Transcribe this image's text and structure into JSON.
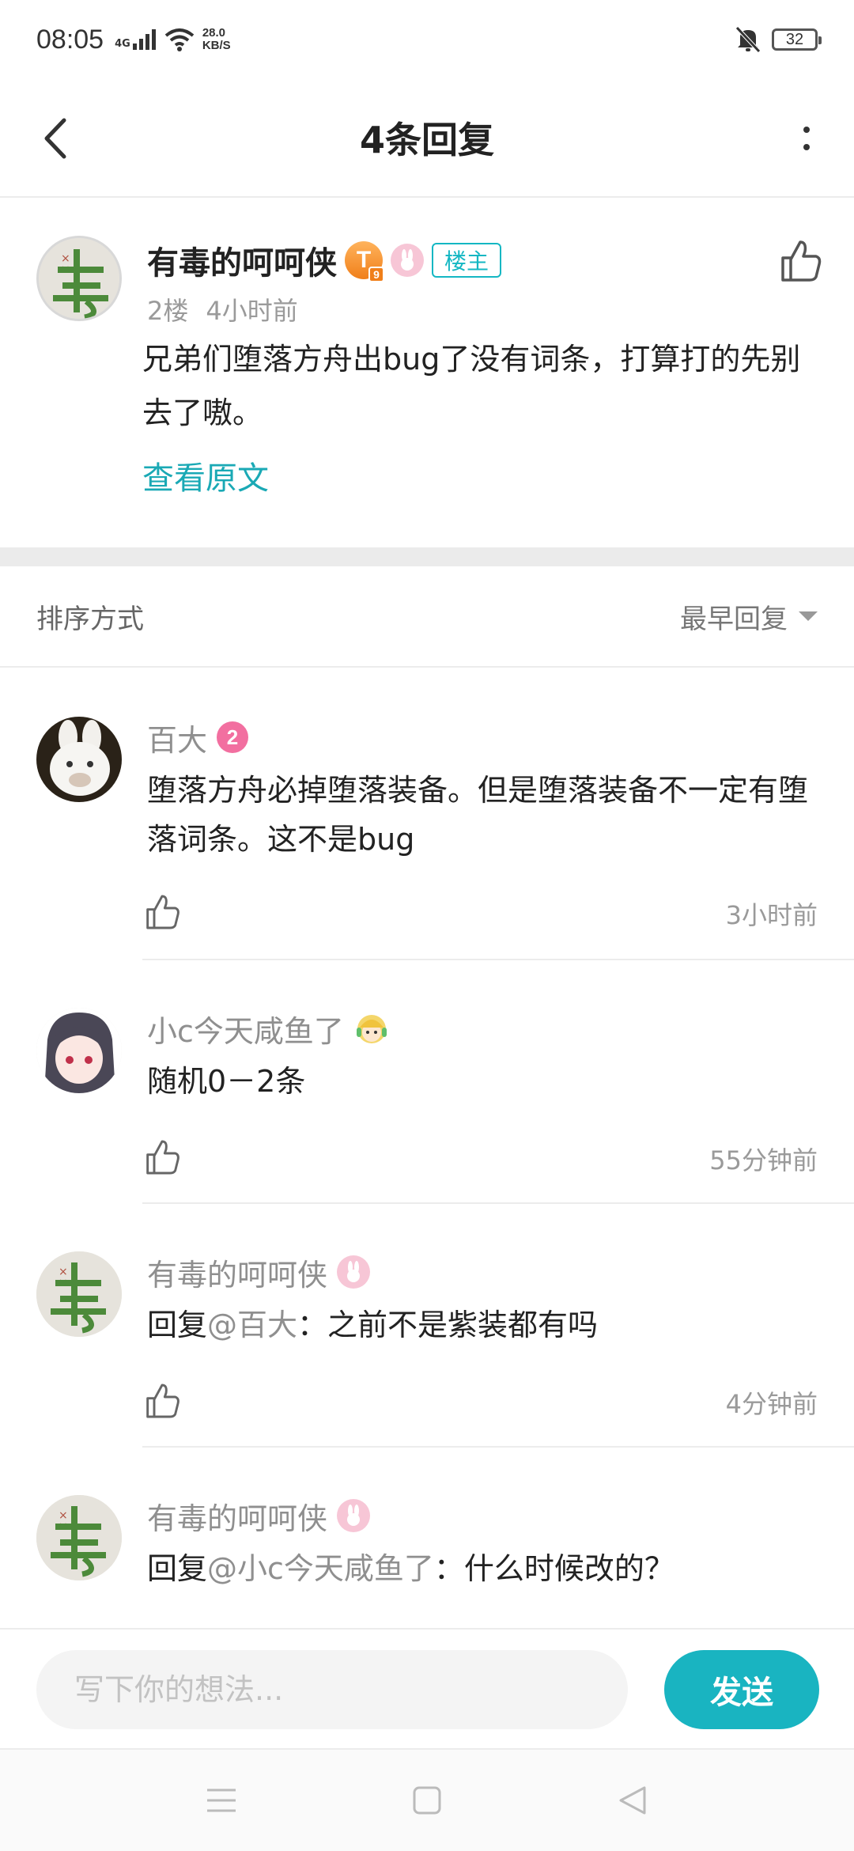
{
  "status_bar": {
    "time": "08:05",
    "network": "4G",
    "speed_value": "28.0",
    "speed_unit": "KB/S",
    "battery": "32"
  },
  "header": {
    "title": "4条回复"
  },
  "post": {
    "author": "有毒的呵呵侠",
    "level_badge": "T",
    "level_sub": "9",
    "owner_tag": "楼主",
    "floor": "2楼",
    "time": "4小时前",
    "content": "兄弟们堕落方舟出bug了没有词条，打算打的先别去了嗷。",
    "view_original": "查看原文"
  },
  "sort": {
    "label": "排序方式",
    "selected": "最早回复"
  },
  "replies": [
    {
      "name": "百大",
      "badge": "2",
      "text": "堕落方舟必掉堕落装备。但是堕落装备不一定有堕落词条。这不是bug",
      "time": "3小时前"
    },
    {
      "name": "小c今天咸鱼了",
      "text": "随机0－2条",
      "time": "55分钟前"
    },
    {
      "name": "有毒的呵呵侠",
      "reply_prefix": "回复",
      "mention": "@百大",
      "text": "：之前不是紫装都有吗",
      "time": "4分钟前"
    },
    {
      "name": "有毒的呵呵侠",
      "reply_prefix": "回复",
      "mention": "@小c今天咸鱼了",
      "text": "：什么时候改的？"
    }
  ],
  "composer": {
    "placeholder": "写下你的想法...",
    "send_label": "发送"
  },
  "colors": {
    "accent": "#19b4c1",
    "owner_tag": "#14b7c3",
    "link": "#1aa9b5"
  }
}
